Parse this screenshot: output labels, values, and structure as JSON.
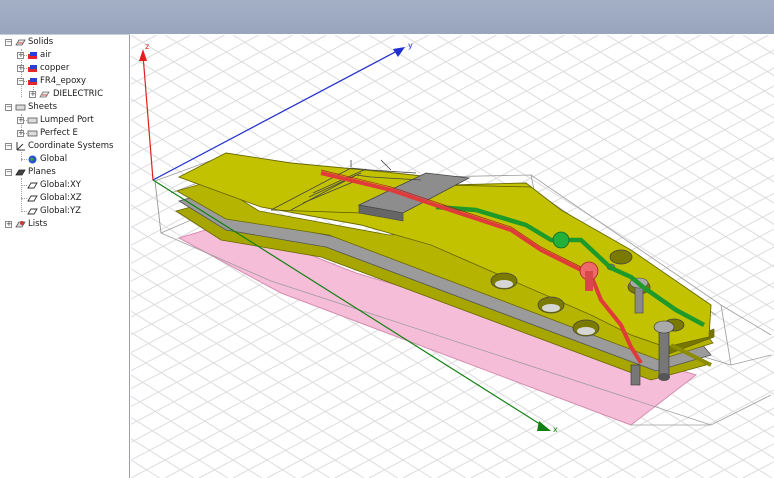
{
  "tree": {
    "solids": "Solids",
    "air": "air",
    "copper": "copper",
    "fr4": "FR4_epoxy",
    "dielectric": "DIELECTRIC",
    "sheets": "Sheets",
    "lumped_port": "Lumped Port",
    "perfect_e": "Perfect E",
    "coord_systems": "Coordinate Systems",
    "global": "Global",
    "planes": "Planes",
    "plane_xy": "Global:XY",
    "plane_xz": "Global:XZ",
    "plane_yz": "Global:YZ",
    "lists": "Lists"
  },
  "viewport": {
    "axis_z": "z",
    "axis_y": "y",
    "axis_x": "x"
  },
  "colors": {
    "titlebar": "#98a5bd",
    "board": "#b5b400",
    "ground": "#999999",
    "trace_red": "#e23a3a",
    "trace_green": "#22aa22",
    "pink_plane": "#f4b8d6",
    "axis_red": "#e02020",
    "axis_blue": "#2030d0",
    "axis_green": "#108010"
  }
}
